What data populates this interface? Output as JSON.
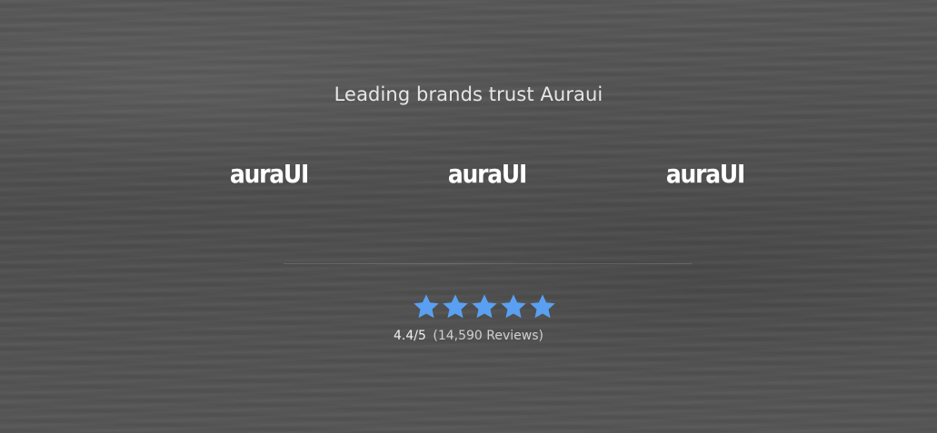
{
  "section": {
    "heading": "Leading brands trust Auraui"
  },
  "logos": [
    {
      "text": "auraUI",
      "icon": "auraui-logo"
    },
    {
      "text": "auraUI",
      "icon": "auraui-logo"
    },
    {
      "text": "auraUI",
      "icon": "auraui-logo"
    }
  ],
  "rating": {
    "stars": 5,
    "star_color": "#5aa0f2",
    "value": "4.4/5",
    "reviews": "(14,590 Reviews)"
  }
}
